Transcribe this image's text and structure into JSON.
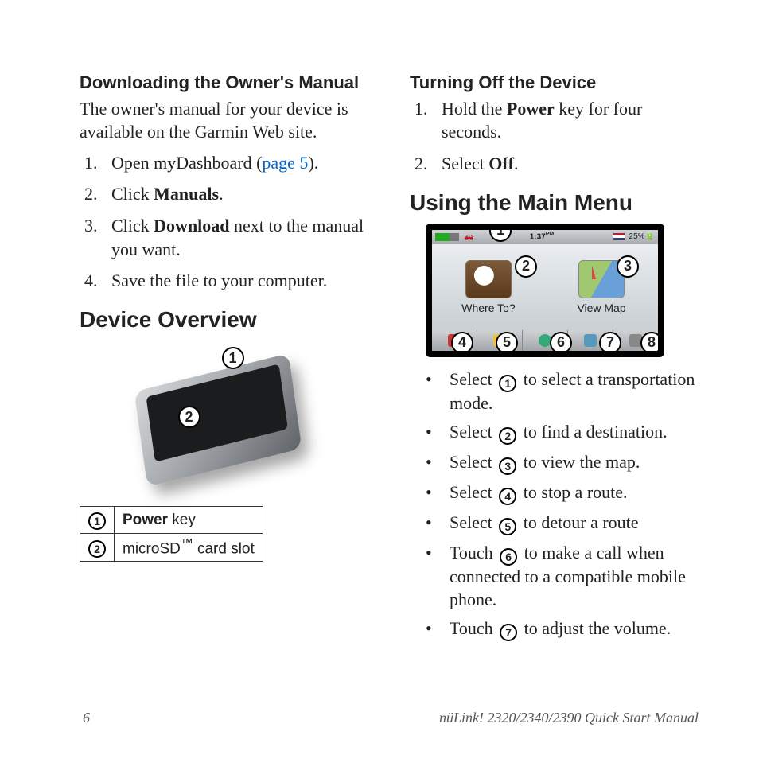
{
  "left": {
    "dl_heading": "Downloading the Owner's Manual",
    "dl_para": "The owner's manual for your device is available on the Garmin Web site.",
    "steps": {
      "s1a": "Open myDashboard (",
      "s1link": "page 5",
      "s1b": ").",
      "s2a": "Click ",
      "s2bold": "Manuals",
      "s2b": ".",
      "s3a": "Click ",
      "s3bold": "Download",
      "s3b": " next to the manual you want.",
      "s4": "Save the file to your computer."
    },
    "overview_heading": "Device Overview",
    "table": {
      "r1_num": "1",
      "r1_bold": "Power",
      "r1_rest": " key",
      "r2_num": "2",
      "r2_a": "microSD",
      "r2_tm": "™",
      "r2_b": " card slot"
    }
  },
  "right": {
    "off_heading": "Turning Off the Device",
    "off": {
      "s1a": "Hold the ",
      "s1bold": "Power",
      "s1b": " key for four seconds.",
      "s2a": "Select ",
      "s2bold": "Off",
      "s2b": "."
    },
    "menu_heading": "Using the Main Menu",
    "device": {
      "time": "1:37",
      "batt": "25",
      "where": "Where To?",
      "viewmap": "View Map"
    },
    "bullets": {
      "b1a": "Select ",
      "b1n": "1",
      "b1b": " to select a transportation mode.",
      "b2a": "Select ",
      "b2n": "2",
      "b2b": " to find a destination.",
      "b3a": "Select ",
      "b3n": "3",
      "b3b": " to view the map.",
      "b4a": "Select ",
      "b4n": "4",
      "b4b": " to stop a route.",
      "b5a": "Select ",
      "b5n": "5",
      "b5b": " to detour a route",
      "b6a": "Touch ",
      "b6n": "6",
      "b6b": " to make a call when connected to a compatible mobile phone.",
      "b7a": "Touch ",
      "b7n": "7",
      "b7b": " to adjust the volume."
    }
  },
  "footer": {
    "page": "6",
    "title": "nüLink! 2320/2340/2390 Quick Start Manual"
  },
  "callouts": {
    "c1": "1",
    "c2": "2",
    "c3": "3",
    "c4": "4",
    "c5": "5",
    "c6": "6",
    "c7": "7",
    "c8": "8"
  }
}
